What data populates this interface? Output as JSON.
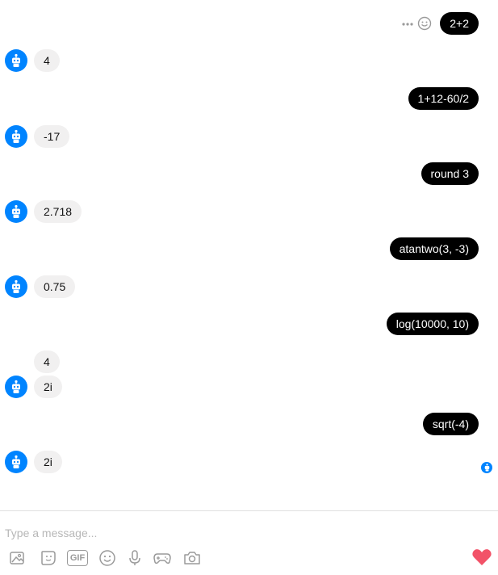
{
  "messages": [
    {
      "from": "user",
      "text": "2+2"
    },
    {
      "from": "bot",
      "text": "4"
    },
    {
      "from": "user",
      "text": "1+12-60/2"
    },
    {
      "from": "bot",
      "text": "-17"
    },
    {
      "from": "user",
      "text": "round 3"
    },
    {
      "from": "bot",
      "text": "2.718"
    },
    {
      "from": "user",
      "text": "atantwo(3, -3)"
    },
    {
      "from": "bot",
      "text": "0.75"
    },
    {
      "from": "user",
      "text": "log(10000, 10)"
    },
    {
      "from": "bot",
      "text": "4"
    },
    {
      "from": "bot",
      "text": "2i"
    },
    {
      "from": "user",
      "text": "sqrt(-4)"
    },
    {
      "from": "bot",
      "text": "2i"
    }
  ],
  "composer": {
    "placeholder": "Type a message...",
    "gif_label": "GIF"
  },
  "icons": {
    "message_actions": [
      "more-options-icon",
      "emoji-reaction-icon"
    ],
    "toolbar": [
      "image-icon",
      "sticker-icon",
      "gif-icon",
      "emoji-icon",
      "microphone-icon",
      "game-controller-icon",
      "camera-icon"
    ],
    "send": "heart-icon",
    "avatar": "bot-icon",
    "seen": "seen-avatar-icon"
  },
  "colors": {
    "outgoing_bubble": "#000000",
    "incoming_bubble": "#f1f0f0",
    "accent": "#0084ff",
    "heart": "#f25268"
  }
}
